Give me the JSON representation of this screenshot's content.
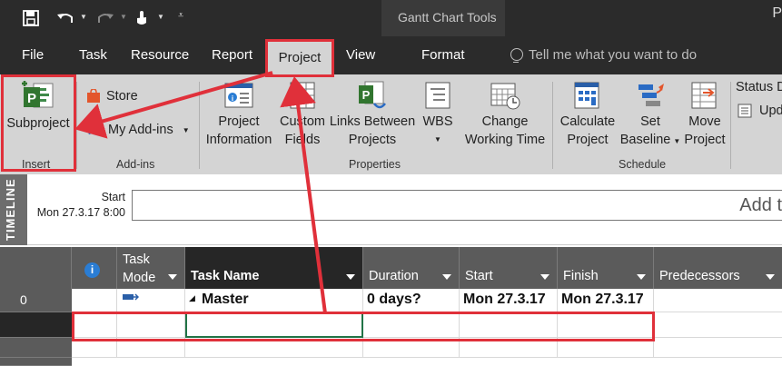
{
  "title_bar": {
    "context_tab_label": "Gantt Chart Tools",
    "window_edge_letter": "P"
  },
  "tabs": {
    "file": "File",
    "task": "Task",
    "resource": "Resource",
    "report": "Report",
    "project": "Project",
    "view": "View",
    "format": "Format",
    "tell_me_placeholder": "Tell me what you want to do"
  },
  "ribbon": {
    "insert": {
      "subproject": "Subproject",
      "group_label": "Insert"
    },
    "addins": {
      "store": "Store",
      "my_addins": "My Add-ins",
      "group_label": "Add-ins"
    },
    "properties": {
      "project_information_l1": "Project",
      "project_information_l2": "Information",
      "custom_fields_l1": "Custom",
      "custom_fields_l2": "Fields",
      "links_between_l1": "Links Between",
      "links_between_l2": "Projects",
      "wbs": "WBS",
      "change_wt_l1": "Change",
      "change_wt_l2": "Working Time",
      "group_label": "Properties"
    },
    "schedule": {
      "calculate_l1": "Calculate",
      "calculate_l2": "Project",
      "set_baseline_l1": "Set",
      "set_baseline_l2": "Baseline",
      "move_l1": "Move",
      "move_l2": "Project",
      "group_label": "Schedule"
    },
    "status": {
      "status_date": "Status D",
      "update": "Upd"
    }
  },
  "timeline": {
    "strip_label": "TIMELINE",
    "start_label": "Start",
    "start_date": "Mon 27.3.17 8:00",
    "add_placeholder": "Add t"
  },
  "grid": {
    "headers": {
      "info": "i",
      "task_mode_l1": "Task",
      "task_mode_l2": "Mode",
      "task_name": "Task Name",
      "duration": "Duration",
      "start": "Start",
      "finish": "Finish",
      "predecessors": "Predecessors"
    },
    "rows": [
      {
        "id": "0",
        "task_name": "Master",
        "duration": "0 days?",
        "start": "Mon 27.3.17",
        "finish": "Mon 27.3.17"
      }
    ]
  },
  "colors": {
    "dark_bg": "#2b2b2b",
    "ribbon_bg": "#d4d4d4",
    "header_bg": "#5b5b5b",
    "highlight_red": "#e0303a"
  }
}
